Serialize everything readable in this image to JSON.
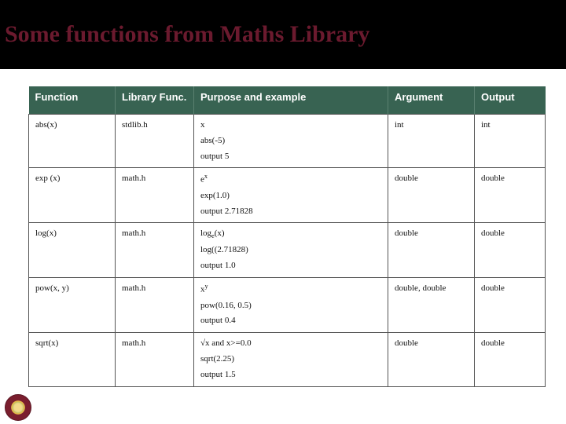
{
  "title": "Some functions from Maths Library",
  "headers": {
    "function": "Function",
    "lib": "Library Func.",
    "purpose": "Purpose and example",
    "argument": "Argument",
    "output": "Output"
  },
  "rows": [
    {
      "func": "abs(x)",
      "lib": "stdlib.h",
      "purpose_html": "x<br>abs(-5)<br>output 5",
      "arg": "int",
      "out": "int"
    },
    {
      "func": "exp (x)",
      "lib": "math.h",
      "purpose_html": "e<sup>x</sup><br>exp(1.0)<br>output 2.71828",
      "arg": "double",
      "out": "double"
    },
    {
      "func": "log(x)",
      "lib": "math.h",
      "purpose_html": "log<sub>e</sub>(x)<br>log((2.71828)<br>output 1.0",
      "arg": "double",
      "out": "double"
    },
    {
      "func": "pow(x, y)",
      "lib": "math.h",
      "purpose_html": "x<sup>y</sup><br>pow(0.16, 0.5)<br>output 0.4",
      "arg": "double, double",
      "out": "double"
    },
    {
      "func": "sqrt(x)",
      "lib": "math.h",
      "purpose_html": "√x and x>=0.0<br>sqrt(2.25)<br>output 1.5",
      "arg": "double",
      "out": "double"
    }
  ]
}
